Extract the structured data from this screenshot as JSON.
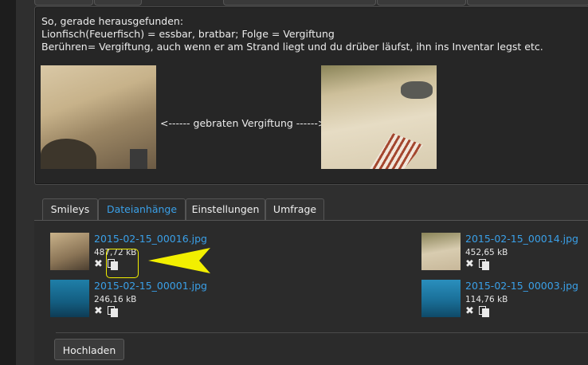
{
  "post": {
    "lines": [
      "So, gerade herausgefunden:",
      "Lionfisch(Feuerfisch) = essbar, bratbar; Folge = Vergiftung",
      "Berühren= Vergiftung, auch wenn er am Strand liegt und du drüber läufst, ihn ins Inventar legst etc."
    ],
    "image_caption": "<------ gebraten Vergiftung ------>"
  },
  "tabs": [
    {
      "label": "Smileys"
    },
    {
      "label": "Dateianhänge"
    },
    {
      "label": "Einstellungen"
    },
    {
      "label": "Umfrage"
    }
  ],
  "attachments": [
    {
      "name": "2015-02-15_00016.jpg",
      "size": "487,72 kB"
    },
    {
      "name": "2015-02-15_00014.jpg",
      "size": "452,65 kB"
    },
    {
      "name": "2015-02-15_00001.jpg",
      "size": "246,16 kB"
    },
    {
      "name": "2015-02-15_00003.jpg",
      "size": "114,76 kB"
    }
  ],
  "icons": {
    "delete": "×-delete-icon",
    "insert": "copy-insert-icon"
  },
  "colors": {
    "link": "#3aa0e8",
    "highlight": "#f2ef00",
    "background": "#2b2b2b"
  },
  "upload_button": {
    "label": "Hochladen"
  }
}
